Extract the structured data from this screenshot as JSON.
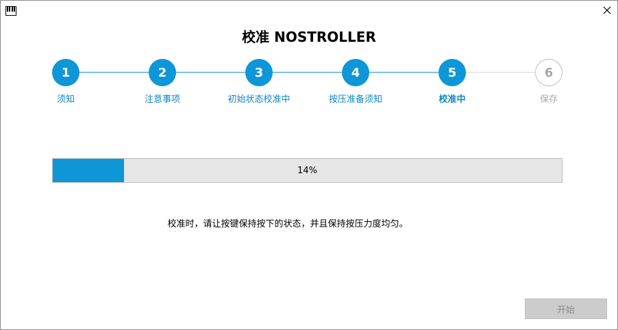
{
  "window": {
    "app_icon": "piano-keyboard-icon",
    "close_icon": "close-icon"
  },
  "title": "校准 NOSTROLLER",
  "steps": [
    {
      "number": "1",
      "label": "须知",
      "state": "done"
    },
    {
      "number": "2",
      "label": "注意事项",
      "state": "done"
    },
    {
      "number": "3",
      "label": "初始状态校准中",
      "state": "done"
    },
    {
      "number": "4",
      "label": "按压准备须知",
      "state": "done"
    },
    {
      "number": "5",
      "label": "校准中",
      "state": "current"
    },
    {
      "number": "6",
      "label": "保存",
      "state": "todo"
    }
  ],
  "progress": {
    "percent": 14,
    "text": "14%"
  },
  "instruction": "校准时，请让按键保持按下的状态，并且保持按压力度均匀。",
  "start_button": {
    "label": "开始",
    "enabled": false
  },
  "colors": {
    "accent": "#0e96d8",
    "inactive": "#a8a8a8"
  }
}
